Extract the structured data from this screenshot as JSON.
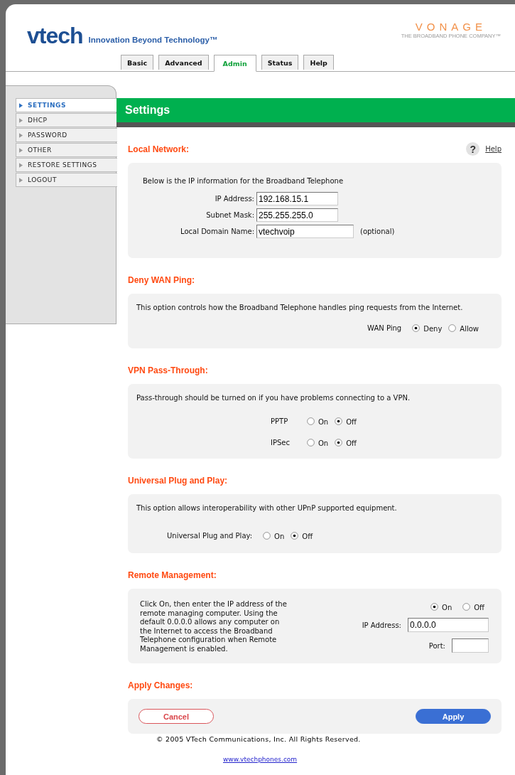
{
  "header": {
    "logo_text": "vtech",
    "tagline": "Innovation Beyond Technology™",
    "partner_name": "VONAGE",
    "partner_tagline": "THE BROADBAND PHONE COMPANY™"
  },
  "tabs": [
    {
      "label": "Basic",
      "selected": false
    },
    {
      "label": "Advanced",
      "selected": false
    },
    {
      "label": "Admin",
      "selected": true
    },
    {
      "label": "Status",
      "selected": false
    },
    {
      "label": "Help",
      "selected": false
    }
  ],
  "sidebar": {
    "items": [
      {
        "label": "SETTINGS",
        "selected": true
      },
      {
        "label": "DHCP",
        "selected": false
      },
      {
        "label": "PASSWORD",
        "selected": false
      },
      {
        "label": "OTHER",
        "selected": false
      },
      {
        "label": "RESTORE SETTINGS",
        "selected": false
      },
      {
        "label": "LOGOUT",
        "selected": false
      }
    ]
  },
  "page_title": "Settings",
  "help_icon": "?",
  "help_link": "Help",
  "sections": [
    {
      "kind": "form",
      "title": "Local Network:",
      "description": "Below is the IP information for the Broadband Telephone",
      "rows": [
        {
          "kind": "field",
          "label": "IP Address:",
          "value": "192.168.15.1"
        },
        {
          "kind": "field",
          "label": "Subnet Mask:",
          "value": "255.255.255.0"
        },
        {
          "kind": "field",
          "label": "Local Domain Name:",
          "value": "vtechvoip",
          "note": "(optional)"
        }
      ]
    },
    {
      "kind": "form",
      "title": "Deny WAN Ping:",
      "description": "This option controls how the Broadband Telephone handles ping requests from the Internet.",
      "rows": [
        {
          "kind": "radio",
          "label": "WAN Ping",
          "options": [
            {
              "label": "Deny",
              "selected": true
            },
            {
              "label": "Allow",
              "selected": false
            }
          ]
        }
      ]
    },
    {
      "kind": "form",
      "title": "VPN Pass-Through:",
      "description": "Pass-through should be turned on if you have problems connecting to a VPN.",
      "rows": [
        {
          "kind": "radio",
          "label": "PPTP",
          "options": [
            {
              "label": "On",
              "selected": false
            },
            {
              "label": "Off",
              "selected": true
            }
          ]
        },
        {
          "kind": "radio",
          "label": "IPSec",
          "options": [
            {
              "label": "On",
              "selected": false
            },
            {
              "label": "Off",
              "selected": true
            }
          ]
        }
      ]
    },
    {
      "kind": "form",
      "title": "Universal Plug and Play:",
      "description": "This option allows interoperability with other UPnP supported equipment.",
      "rows": [
        {
          "kind": "radio",
          "label": "Universal Plug and Play:",
          "options": [
            {
              "label": "On",
              "selected": false
            },
            {
              "label": "Off",
              "selected": true
            }
          ]
        }
      ]
    },
    {
      "kind": "split",
      "title": "Remote Management:",
      "description": "Click On, then enter the IP address of the remote managing computer. Using the default 0.0.0.0 allows any computer on the Internet to access the Broadband Telephone configuration when Remote Management is enabled.",
      "rows": [
        {
          "kind": "radio",
          "options": [
            {
              "label": "On",
              "selected": true
            },
            {
              "label": "Off",
              "selected": false
            }
          ]
        },
        {
          "kind": "field",
          "label": "IP Address:",
          "value": "0.0.0.0"
        },
        {
          "kind": "field",
          "label": "Port:"
        }
      ]
    },
    {
      "kind": "actions",
      "title": "Apply Changes:",
      "buttons": [
        {
          "kind": "secondary",
          "label": "Cancel"
        },
        {
          "kind": "primary",
          "label": "Apply"
        }
      ]
    }
  ],
  "footer": {
    "copyright": "© 2005 VTech Communications, Inc. All Rights Reserved.",
    "link": "www.vtechphones.com"
  }
}
